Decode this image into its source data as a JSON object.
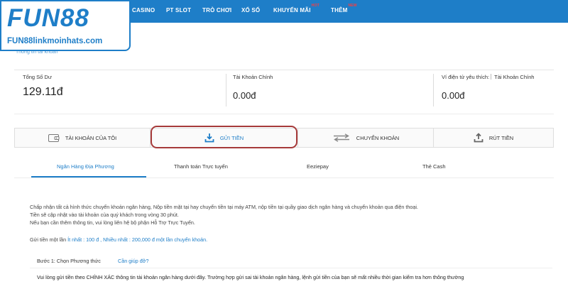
{
  "logo": {
    "main": "FUN88",
    "sub": "FUN88linkmoinhats.com"
  },
  "nav": {
    "items": [
      {
        "label": "CASINO",
        "badge": ""
      },
      {
        "label": "PT SLOT",
        "badge": ""
      },
      {
        "label": "TRÒ CHƠI",
        "badge": ""
      },
      {
        "label": "XỔ SỐ",
        "badge": ""
      },
      {
        "label": "KHUYẾN MÃI",
        "badge": "HOT"
      },
      {
        "label": "THÊM",
        "badge": "NEW"
      }
    ]
  },
  "breadcrumb": "Thông tin tài khoản",
  "balances": [
    {
      "label": "Tổng Số Dư",
      "value": "129.11đ"
    },
    {
      "label": "Tài Khoản Chính",
      "value": "0.00đ"
    },
    {
      "label": "Ví điện tử yêu thích:",
      "selected": "Tài Khoản Chính",
      "value": "0.00đ"
    }
  ],
  "actions": [
    {
      "label": "TÀI KHOẢN CỦA TÔI",
      "icon": "wallet-icon"
    },
    {
      "label": "GỬI TIỀN",
      "icon": "download-icon"
    },
    {
      "label": "CHUYỂN KHOẢN",
      "icon": "transfer-arrows-icon"
    },
    {
      "label": "RÚT TIỀN",
      "icon": "upload-icon"
    }
  ],
  "bank_tabs": [
    "Ngân Hàng Địa Phương",
    "Thanh toán Trực tuyến",
    "Eeziepay",
    "Thẻ Cash"
  ],
  "info": {
    "line1": "Chấp nhận tất cả hình thức chuyển khoản ngân hàng, Nộp tiền mặt tại hay chuyển tiền tại máy ATM, nộp tiền tại quầy giao dịch ngân hàng và chuyển khoản qua điện thoại.",
    "line2": "Tiền sẽ cập nhật vào tài khoản của quý khách trong vòng 30 phút.",
    "line3": "Nếu bạn cần thêm thông tin, vui lòng liên hệ bộ phận Hỗ Trợ Trực Tuyến.",
    "limit_prefix": "Gửi tiền một lần",
    "limit_text": "Ít nhất : 100 đ , Nhiều nhất : 200,000 đ một lần chuyển khoản."
  },
  "step": {
    "label": "Bước 1: Chọn Phương thức",
    "help": "Cần giúp đỡ?"
  },
  "notice": "Vui lòng gửi tiền theo CHÍNH XÁC thông tin tài khoản ngân hàng dưới đây. Trường hợp gửi sai tài khoản ngân hàng, lệnh gửi tiền của bạn sẽ mất nhiều thời gian kiểm tra hơn thông thường",
  "colors": {
    "brand_blue": "#1e7ec8",
    "highlight": "#a63a3a",
    "badge_red": "#ff3b3b"
  }
}
